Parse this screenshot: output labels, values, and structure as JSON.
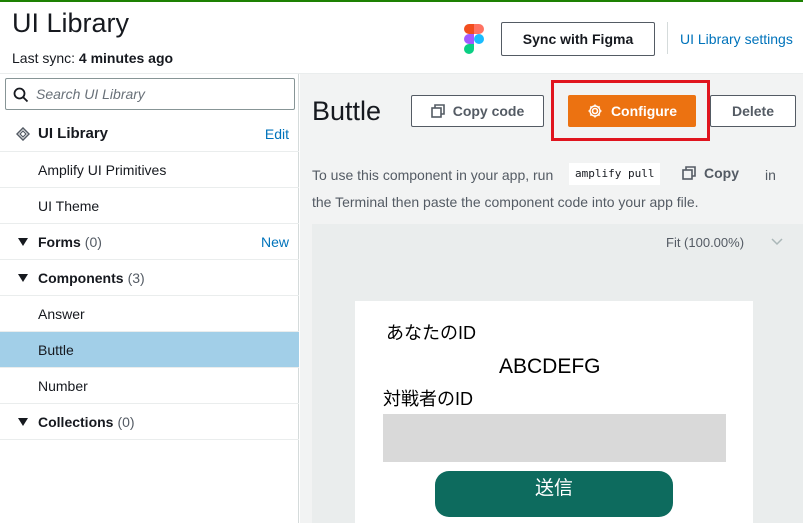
{
  "header": {
    "title": "UI Library",
    "last_sync_label": "Last sync:",
    "last_sync_value": "4 minutes ago",
    "sync_button": "Sync with Figma",
    "settings_link": "UI Library settings"
  },
  "sidebar": {
    "search_placeholder": "Search UI Library",
    "library_title": "UI Library",
    "library_edit": "Edit",
    "items": [
      {
        "label": "Amplify UI Primitives"
      },
      {
        "label": "UI Theme"
      }
    ],
    "forms": {
      "label": "Forms",
      "count": "(0)",
      "action": "New"
    },
    "components": {
      "label": "Components",
      "count": "(3)",
      "items": [
        "Answer",
        "Buttle",
        "Number"
      ],
      "selected": "Buttle"
    },
    "collections": {
      "label": "Collections",
      "count": "(0)"
    }
  },
  "main": {
    "component_title": "Buttle",
    "copy_code": "Copy code",
    "configure": "Configure",
    "delete": "Delete",
    "hint_before": "To use this component in your app, run",
    "command": "amplify pull",
    "copy": "Copy",
    "hint_in": "in",
    "hint_after": "the Terminal then paste the component code into your app file.",
    "zoom": "Fit (100.00%)"
  },
  "preview": {
    "label1": "あなたのID",
    "value": "ABCDEFG",
    "label2": "対戦者のID",
    "button": "送信"
  },
  "colors": {
    "accent": "#ec7211",
    "link": "#0073bb",
    "selected": "#a2cfe8",
    "highlight": "#e0141e",
    "preview_button": "#0d6b5e"
  }
}
